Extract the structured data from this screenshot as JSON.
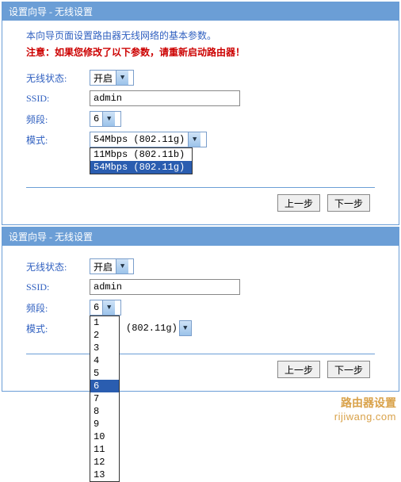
{
  "panel1": {
    "title": "设置向导 - 无线设置",
    "intro": "本向导页面设置路由器无线网络的基本参数。",
    "warn": "注意：如果您修改了以下参数，请重新启动路由器！",
    "rows": {
      "wireless_status": {
        "label": "无线状态:",
        "value": "开启"
      },
      "ssid": {
        "label": "SSID:",
        "value": "admin"
      },
      "channel": {
        "label": "频段:",
        "value": "6"
      },
      "mode": {
        "label": "模式:",
        "value": "54Mbps (802.11g)"
      }
    },
    "mode_options": [
      {
        "text": "11Mbps (802.11b)",
        "hi": false
      },
      {
        "text": "54Mbps (802.11g)",
        "hi": true
      }
    ],
    "buttons": {
      "prev": "上一步",
      "next": "下一步"
    }
  },
  "panel2": {
    "title": "设置向导 - 无线设置",
    "rows": {
      "wireless_status": {
        "label": "无线状态:",
        "value": "开启"
      },
      "ssid": {
        "label": "SSID:",
        "value": "admin"
      },
      "channel": {
        "label": "频段:",
        "value": "6"
      },
      "mode": {
        "label": "模式:",
        "value_suffix": "(802.11g)"
      }
    },
    "channel_options": [
      "1",
      "2",
      "3",
      "4",
      "5",
      "6",
      "7",
      "8",
      "9",
      "10",
      "11",
      "12",
      "13"
    ],
    "channel_selected": "6",
    "buttons": {
      "prev": "上一步",
      "next": "下一步"
    }
  },
  "watermark": {
    "line1": "路由器设置",
    "line2": "rijiwang.com"
  }
}
